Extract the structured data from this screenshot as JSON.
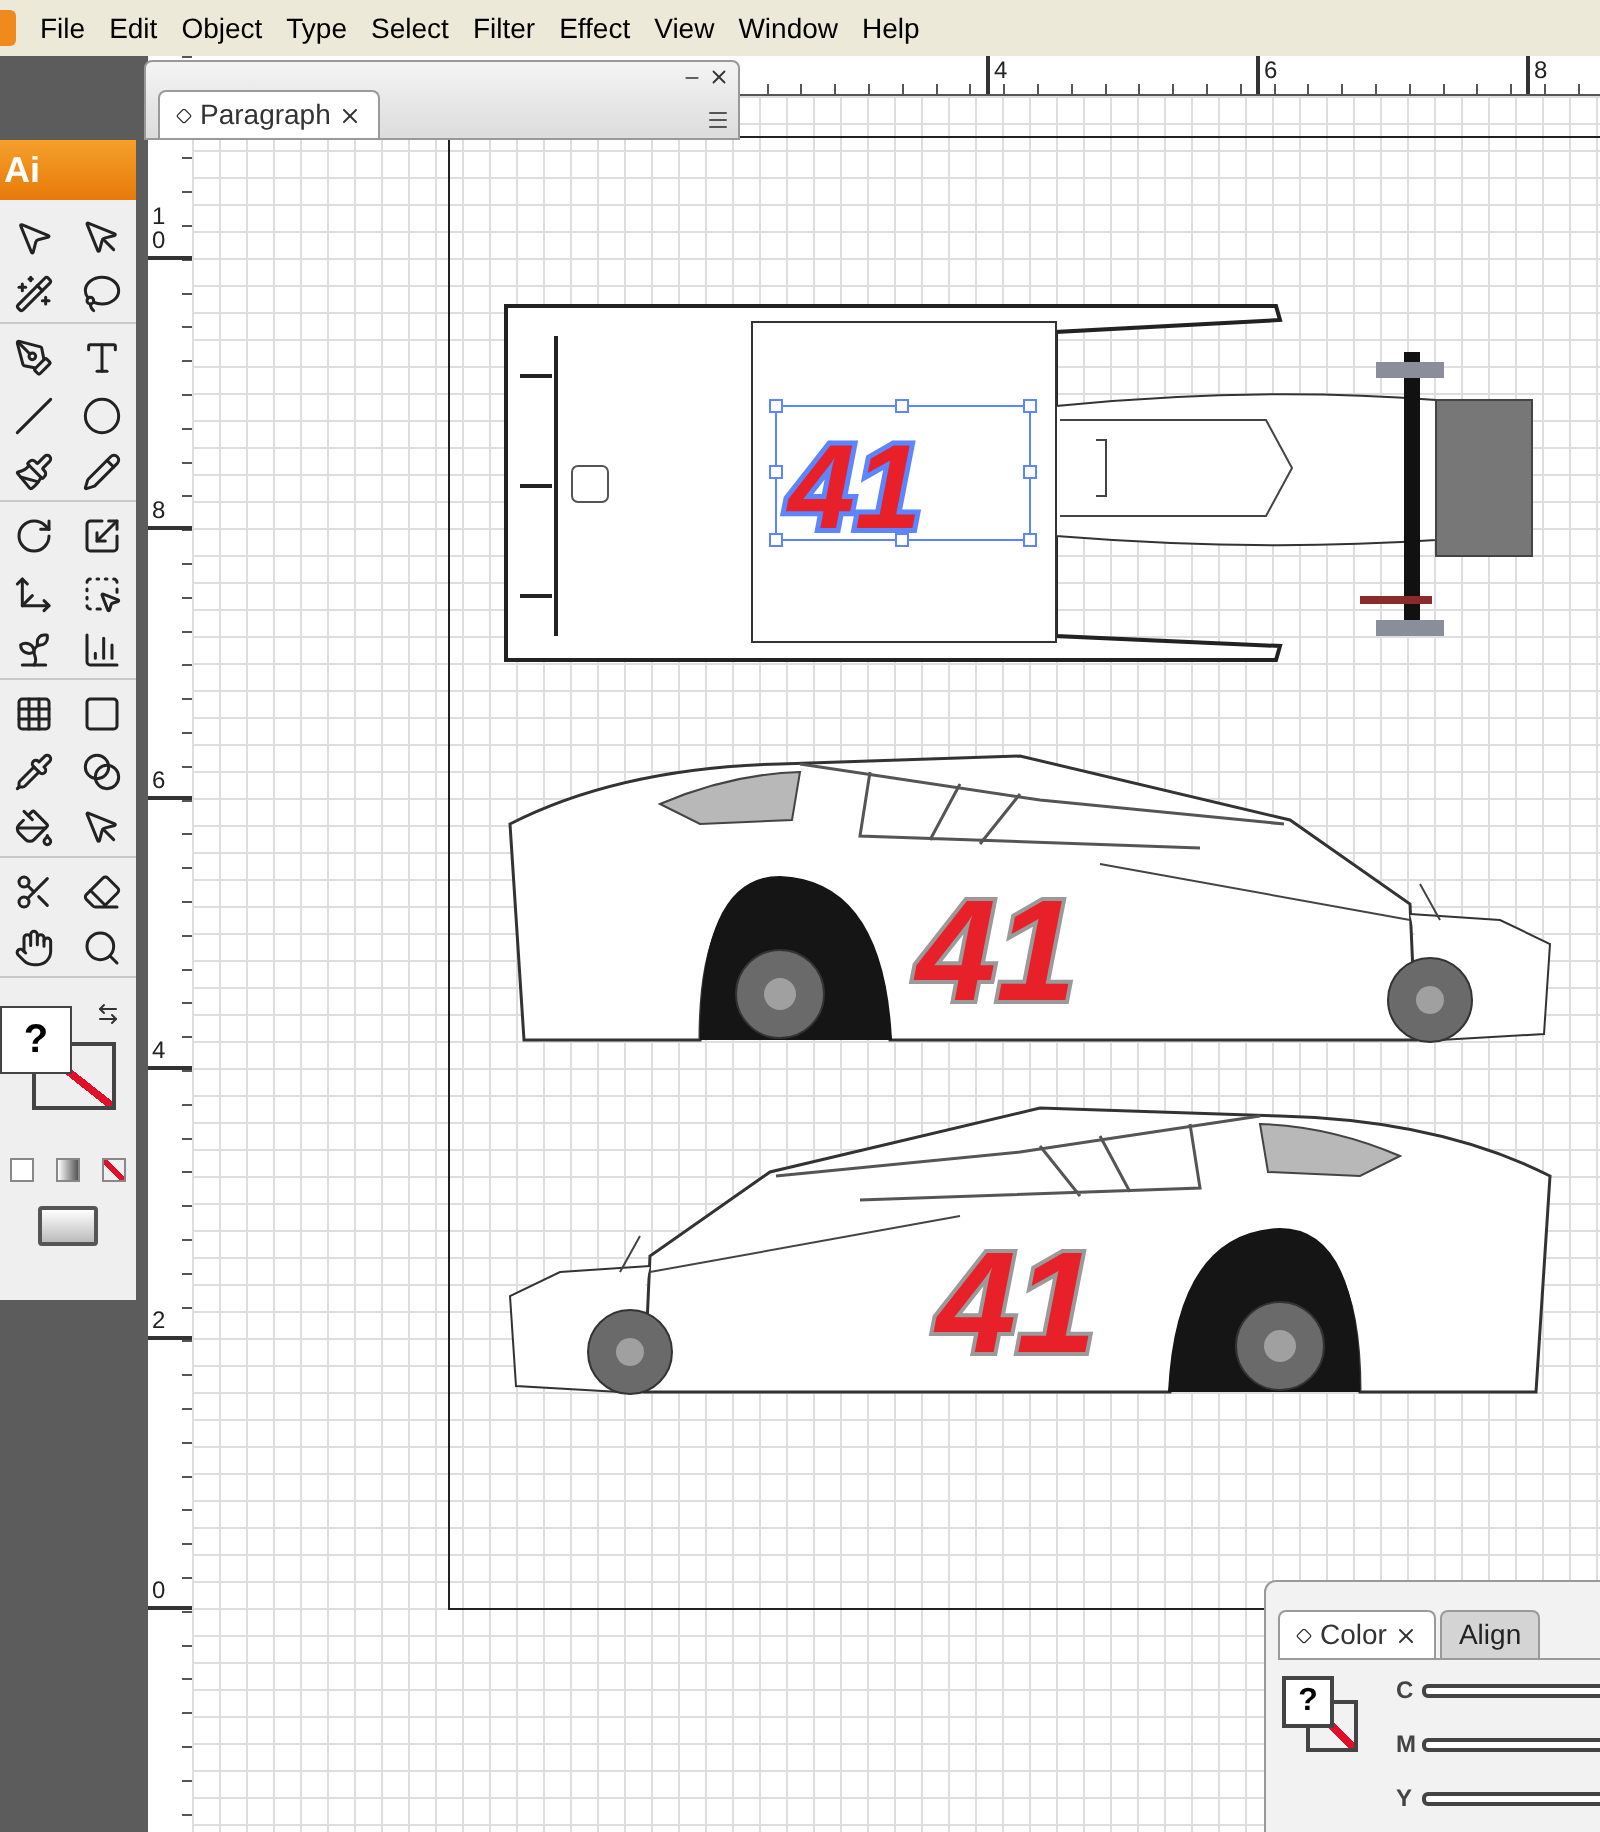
{
  "menu_bar": {
    "items": [
      "File",
      "Edit",
      "Object",
      "Type",
      "Select",
      "Filter",
      "Effect",
      "View",
      "Window",
      "Help"
    ]
  },
  "toolbox": {
    "logo": "Ai",
    "fill_label": "?"
  },
  "paragraph_panel": {
    "tabs": [
      {
        "label": "Paragraph",
        "selected": true
      }
    ]
  },
  "rulers": {
    "horizontal": [
      "4",
      "6",
      "8"
    ],
    "vertical": [
      "10",
      "8",
      "6",
      "4",
      "2",
      "0"
    ]
  },
  "artwork": {
    "top_view_number": "41",
    "side_view_numbers": [
      "41",
      "41"
    ]
  },
  "color_panel": {
    "tabs": [
      {
        "label": "Color",
        "selected": true
      },
      {
        "label": "Align",
        "selected": false
      }
    ],
    "swatch_label": "?",
    "channels": [
      "C",
      "M",
      "Y"
    ]
  }
}
